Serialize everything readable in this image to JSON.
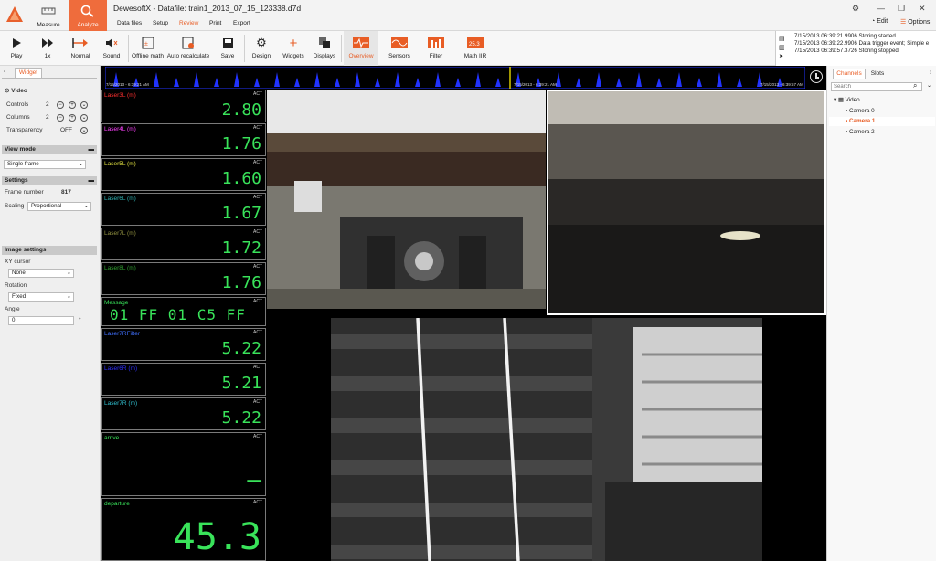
{
  "app": {
    "title": "DewesoftX - Datafile: train1_2013_07_15_123338.d7d"
  },
  "modes": [
    {
      "label": "Measure"
    },
    {
      "label": "Analyze"
    }
  ],
  "menu": [
    "Data files",
    "Setup",
    "Review",
    "Print",
    "Export"
  ],
  "top_right": {
    "edit": "Edit",
    "options": "Options"
  },
  "toolbar": {
    "play": "Play",
    "speed": "1x",
    "normal": "Normal",
    "sound": "Sound",
    "offline_math": "Offline math",
    "auto_recalc": "Auto recalculate",
    "save": "Save",
    "design": "Design",
    "widgets": "Widgets",
    "displays": "Displays",
    "overview": "Overview",
    "sensors": "Sensors",
    "filter": "Filter",
    "math_iir": "Math IIR"
  },
  "events": [
    "7/15/2013 06:39:21.9906 Storing started",
    "7/15/2013 06:39:22.9906 Data trigger event; Simple e",
    "7/15/2013 06:39:57.3726 Storing stopped"
  ],
  "left": {
    "tab": "Widget",
    "video_header": "Video",
    "controls_label": "Controls",
    "controls_value": "2",
    "columns_label": "Columns",
    "columns_value": "2",
    "transparency_label": "Transparency",
    "transparency_value": "OFF",
    "view_mode_header": "View mode",
    "view_mode_value": "Single frame",
    "settings_header": "Settings",
    "frame_number_label": "Frame number",
    "frame_number_value": "817",
    "scaling_label": "Scaling",
    "scaling_value": "Proportional",
    "image_settings_header": "Image settings",
    "xy_cursor_label": "XY cursor",
    "xy_cursor_value": "None",
    "rotation_label": "Rotation",
    "rotation_value": "Fixed",
    "angle_label": "Angle",
    "angle_value": "0",
    "angle_unit": "°"
  },
  "timeline": {
    "start_left": "7/15/2013 - 6:39:21 AM",
    "end_left": "7/15/2013 - 6:39:21 AM",
    "start_right": "7/15/2013 - 6:39:57 AM"
  },
  "meter_act": "ACT",
  "meters": [
    {
      "name": "Laser3L (m)",
      "value": "2.80",
      "color": "#ff3030"
    },
    {
      "name": "Laser4L (m)",
      "value": "1.76",
      "color": "#ff40ff"
    },
    {
      "name": "Laser5L (m)",
      "value": "1.60",
      "color": "#e0e040"
    },
    {
      "name": "Laser6L (m)",
      "value": "1.67",
      "color": "#30b0b0"
    },
    {
      "name": "Laser7L (m)",
      "value": "1.72",
      "color": "#909040"
    },
    {
      "name": "Laser8L (m)",
      "value": "1.76",
      "color": "#30a030"
    },
    {
      "name": "Message",
      "value": "01 FF 01 C5 FF",
      "color": "#39e35a"
    },
    {
      "name": "Laser7RFilter",
      "value": "5.22",
      "color": "#4070ff"
    },
    {
      "name": "Laser6R (m)",
      "value": "5.21",
      "color": "#3030ff"
    },
    {
      "name": "Laser7R (m)",
      "value": "5.22",
      "color": "#30c0d0"
    },
    {
      "name": "arrive",
      "value": "—",
      "color": "#39e35a"
    },
    {
      "name": "departure",
      "value": "45.3",
      "color": "#39e35a"
    }
  ],
  "channels": {
    "tabs": [
      "Channels",
      "Slots"
    ],
    "search_placeholder": "Search",
    "group": "Video",
    "items": [
      "Camera 0",
      "Camera 1",
      "Camera 2"
    ]
  },
  "colors": {
    "accent": "#ef6c3c",
    "meter_value": "#39e35a",
    "selected": "#e85d25"
  }
}
